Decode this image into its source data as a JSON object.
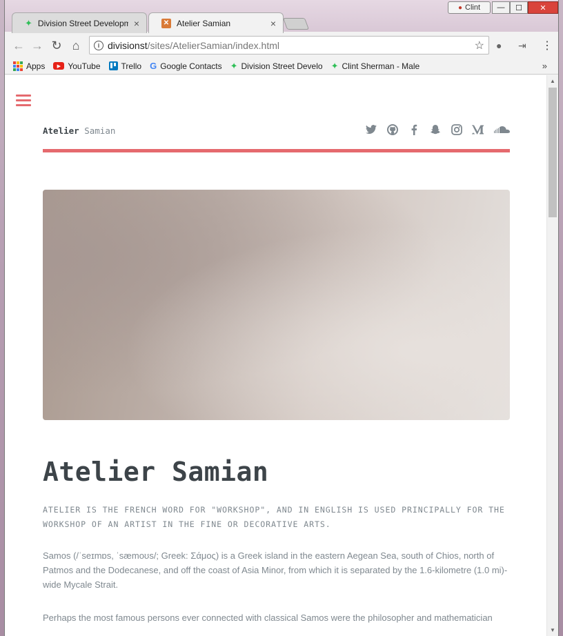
{
  "window": {
    "user": "Clint",
    "buttons": {
      "minimize": "—",
      "maximize": "☐",
      "close": "✕"
    }
  },
  "tabs": [
    {
      "label": "Division Street Developm",
      "close": "×"
    },
    {
      "label": "Atelier Samian",
      "close": "×"
    }
  ],
  "toolbar": {
    "back": "←",
    "forward": "→",
    "reload": "↻",
    "home": "⌂",
    "url_host": "divisionst",
    "url_path": "/sites/AtelierSamian/index.html",
    "star": "☆",
    "menu": "⋮"
  },
  "bookmarks": {
    "items": [
      {
        "label": "Apps",
        "icon": "apps-grid-icon"
      },
      {
        "label": "YouTube",
        "icon": "youtube-icon"
      },
      {
        "label": "Trello",
        "icon": "trello-icon"
      },
      {
        "label": "Google Contacts",
        "icon": "google-icon"
      },
      {
        "label": "Division Street Develo",
        "icon": "sparkle-icon"
      },
      {
        "label": "Clint Sherman - Male",
        "icon": "sparkle-icon"
      }
    ],
    "more": "»"
  },
  "page": {
    "logo_strong": "Atelier",
    "logo_light": " Samian",
    "socials": [
      "twitter-icon",
      "github-icon",
      "facebook-icon",
      "snapchat-icon",
      "instagram-icon",
      "medium-icon",
      "soundcloud-icon"
    ],
    "title": "Atelier Samian",
    "subtitle": "ATELIER IS THE FRENCH WORD FOR \"WORKSHOP\", AND IN ENGLISH IS USED PRINCIPALLY FOR THE WORKSHOP OF AN ARTIST IN THE FINE OR DECORATIVE ARTS.",
    "para1": "Samos (/ˈseɪmɒs, ˈsæmoʊs/; Greek: Σάμος) is a Greek island in the eastern Aegean Sea, south of Chios, north of Patmos and the Dodecanese, and off the coast of Asia Minor, from which it is separated by the 1.6-kilometre (1.0 mi)-wide Mycale Strait.",
    "para2": "Perhaps the most famous persons ever connected with classical Samos were the philosopher and mathematician"
  },
  "colors": {
    "accent": "#e56a6e",
    "heading": "#3d4449",
    "body_text": "#7f888f"
  }
}
